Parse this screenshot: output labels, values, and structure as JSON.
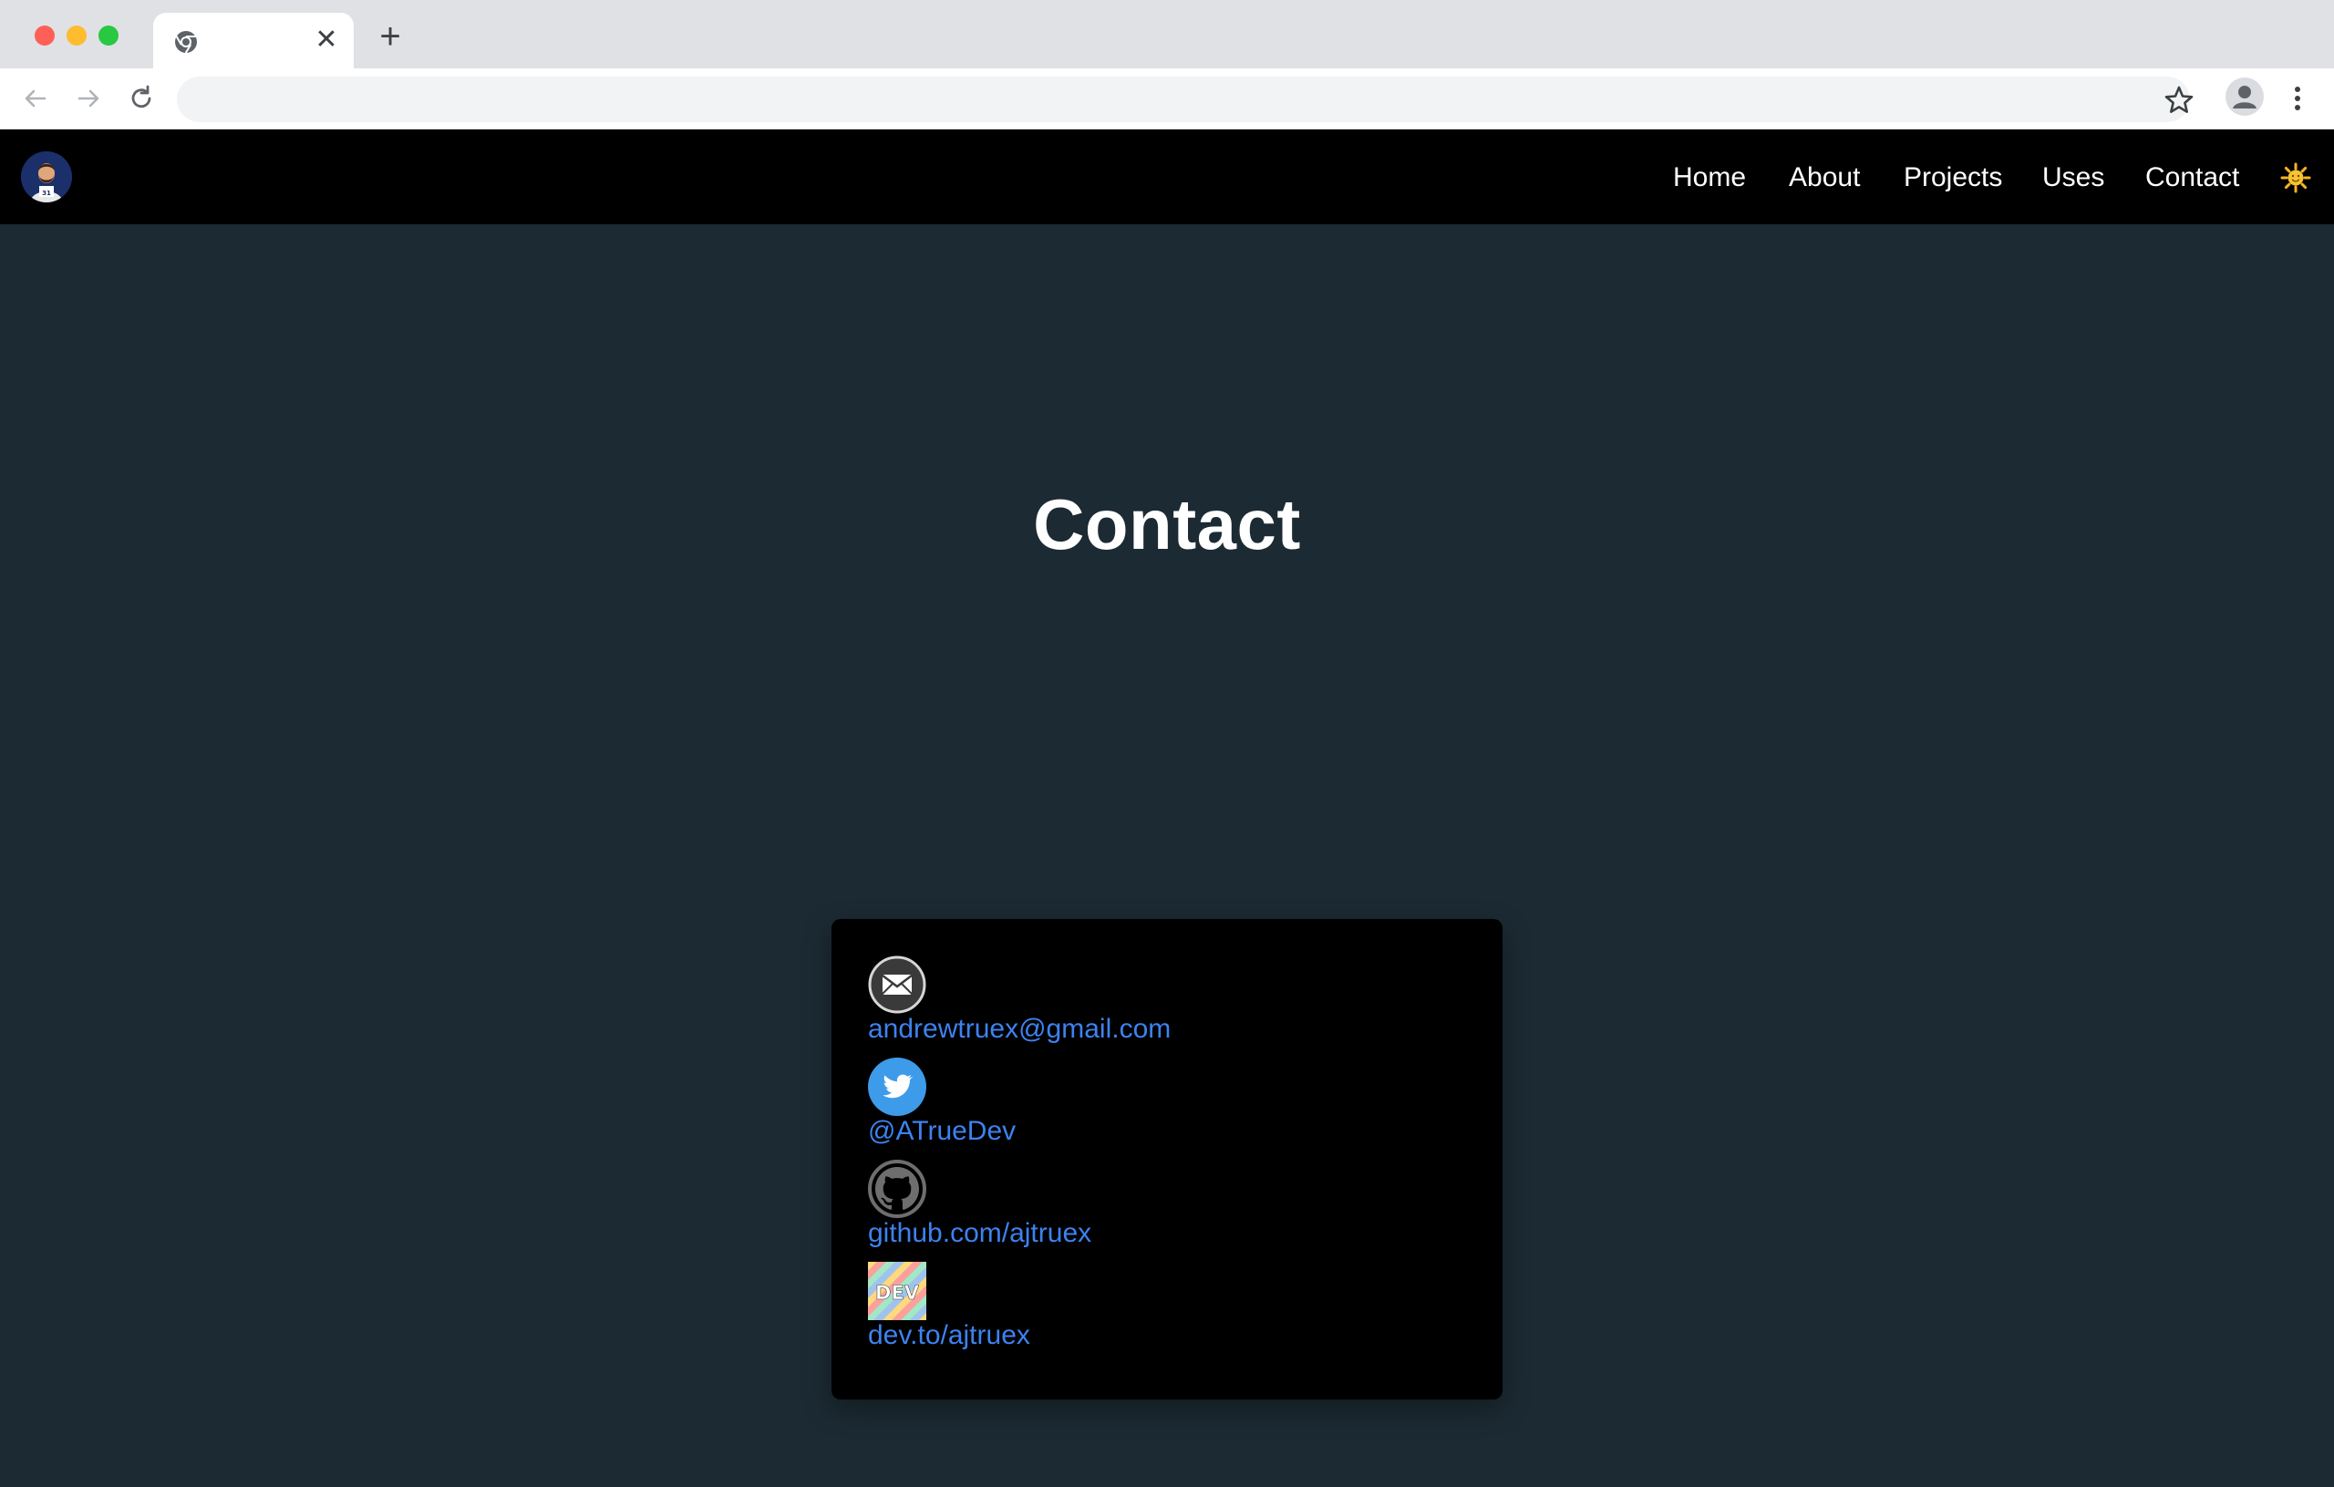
{
  "browser": {
    "address_value": "",
    "address_placeholder": "",
    "tab_close_glyph": "✕",
    "new_tab_glyph": "+"
  },
  "nav": {
    "links": [
      {
        "label": "Home"
      },
      {
        "label": "About"
      },
      {
        "label": "Projects"
      },
      {
        "label": "Uses"
      },
      {
        "label": "Contact"
      }
    ],
    "theme_icon": "sun-icon"
  },
  "page": {
    "title": "Contact"
  },
  "contacts": [
    {
      "icon": "mail-icon",
      "label": "andrewtruex@gmail.com"
    },
    {
      "icon": "twitter-icon",
      "label": "@ATrueDev"
    },
    {
      "icon": "github-icon",
      "label": "github.com/ajtruex"
    },
    {
      "icon": "dev-icon",
      "label": "dev.to/ajtruex"
    }
  ],
  "colors": {
    "page_bg": "#1c2a33",
    "nav_bg": "#000000",
    "card_bg": "#000000",
    "link": "#3d82f0",
    "twitter": "#3d9be9"
  }
}
